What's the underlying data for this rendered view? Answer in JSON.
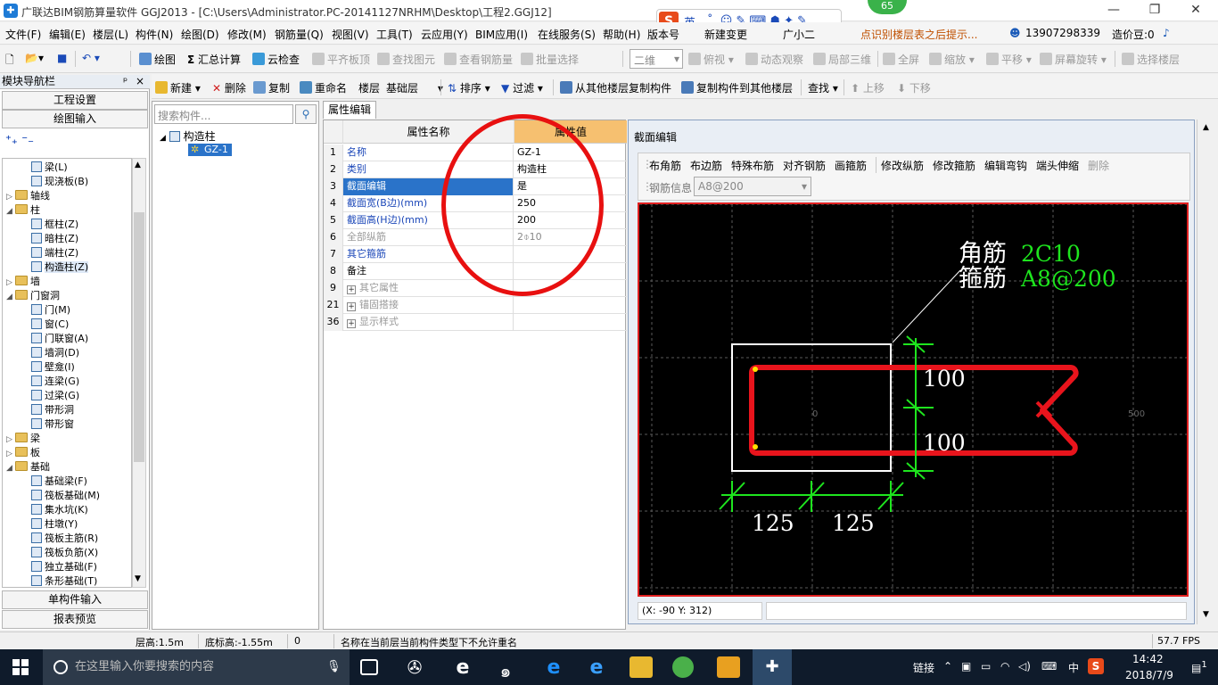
{
  "window": {
    "title": "广联达BIM钢筋算量软件 GGJ2013 - [C:\\Users\\Administrator.PC-20141127NRHM\\Desktop\\工程2.GGJ12]",
    "minimize": "—",
    "restore": "❐",
    "close": "✕"
  },
  "badge": "65",
  "ime": {
    "logo": "S",
    "mode": "英"
  },
  "menu": [
    "文件(F)",
    "编辑(E)",
    "楼层(L)",
    "构件(N)",
    "绘图(D)",
    "修改(M)",
    "钢筋量(Q)",
    "视图(V)",
    "工具(T)",
    "云应用(Y)",
    "BIM应用(I)",
    "在线服务(S)",
    "帮助(H)",
    "版本号",
    "新建变更",
    "广小二"
  ],
  "menu_right": {
    "tip": "点识别楼层表之后提示...",
    "phone": "13907298339",
    "coins": "造价豆:0"
  },
  "toolbar1": {
    "draw": "绘图",
    "calc": "汇总计算",
    "cloud_check": "云检查",
    "align_top": "平齐板顶",
    "find_elem": "查找图元",
    "view_rebar": "查看钢筋量",
    "batch_select": "批量选择",
    "view_mode": "二维",
    "top_view": "俯视",
    "dynamic_view": "动态观察",
    "local_3d": "局部三维",
    "fullscreen": "全屏",
    "zoom": "缩放",
    "pan": "平移",
    "rotate": "屏幕旋转",
    "select_floor": "选择楼层"
  },
  "nav": {
    "header": "模块导航栏",
    "pin": "ᵖ",
    "close": "×",
    "project_settings": "工程设置",
    "drawing_input": "绘图输入",
    "single_input": "单构件输入",
    "report_preview": "报表预览",
    "tree": [
      {
        "label": "梁(L)",
        "indent": 2,
        "type": "item"
      },
      {
        "label": "现浇板(B)",
        "indent": 2,
        "type": "item"
      },
      {
        "label": "轴线",
        "indent": 0,
        "type": "folder",
        "toggle": "▷"
      },
      {
        "label": "柱",
        "indent": 0,
        "type": "folder",
        "toggle": "◢"
      },
      {
        "label": "框柱(Z)",
        "indent": 2,
        "type": "item"
      },
      {
        "label": "暗柱(Z)",
        "indent": 2,
        "type": "item"
      },
      {
        "label": "端柱(Z)",
        "indent": 2,
        "type": "item"
      },
      {
        "label": "构造柱(Z)",
        "indent": 2,
        "type": "item",
        "selected": true
      },
      {
        "label": "墙",
        "indent": 0,
        "type": "folder",
        "toggle": "▷"
      },
      {
        "label": "门窗洞",
        "indent": 0,
        "type": "folder",
        "toggle": "◢"
      },
      {
        "label": "门(M)",
        "indent": 2,
        "type": "item"
      },
      {
        "label": "窗(C)",
        "indent": 2,
        "type": "item"
      },
      {
        "label": "门联窗(A)",
        "indent": 2,
        "type": "item"
      },
      {
        "label": "墙洞(D)",
        "indent": 2,
        "type": "item"
      },
      {
        "label": "壁龛(I)",
        "indent": 2,
        "type": "item"
      },
      {
        "label": "连梁(G)",
        "indent": 2,
        "type": "item"
      },
      {
        "label": "过梁(G)",
        "indent": 2,
        "type": "item"
      },
      {
        "label": "带形洞",
        "indent": 2,
        "type": "item"
      },
      {
        "label": "带形窗",
        "indent": 2,
        "type": "item"
      },
      {
        "label": "梁",
        "indent": 0,
        "type": "folder",
        "toggle": "▷"
      },
      {
        "label": "板",
        "indent": 0,
        "type": "folder",
        "toggle": "▷"
      },
      {
        "label": "基础",
        "indent": 0,
        "type": "folder",
        "toggle": "◢"
      },
      {
        "label": "基础梁(F)",
        "indent": 2,
        "type": "item"
      },
      {
        "label": "筏板基础(M)",
        "indent": 2,
        "type": "item"
      },
      {
        "label": "集水坑(K)",
        "indent": 2,
        "type": "item"
      },
      {
        "label": "柱墩(Y)",
        "indent": 2,
        "type": "item"
      },
      {
        "label": "筏板主筋(R)",
        "indent": 2,
        "type": "item"
      },
      {
        "label": "筏板负筋(X)",
        "indent": 2,
        "type": "item"
      },
      {
        "label": "独立基础(F)",
        "indent": 2,
        "type": "item"
      },
      {
        "label": "条形基础(T)",
        "indent": 2,
        "type": "item"
      }
    ]
  },
  "toolbar2": {
    "new": "新建",
    "delete": "删除",
    "copy": "复制",
    "rename": "重命名",
    "floor_label": "楼层",
    "floor_value": "基础层",
    "sort": "排序",
    "filter": "过滤",
    "copy_from": "从其他楼层复制构件",
    "copy_to": "复制构件到其他楼层",
    "find": "查找",
    "move_up": "上移",
    "move_down": "下移"
  },
  "components": {
    "search_placeholder": "搜索构件...",
    "root": "构造柱",
    "child": "GZ-1"
  },
  "props": {
    "tab": "属性编辑",
    "col_name": "属性名称",
    "col_value": "属性值",
    "rows": [
      {
        "n": "1",
        "k": "名称",
        "v": "GZ-1",
        "style": "blue"
      },
      {
        "n": "2",
        "k": "类别",
        "v": "构造柱",
        "style": "blue"
      },
      {
        "n": "3",
        "k": "截面编辑",
        "v": "是",
        "style": "blue",
        "selected": true
      },
      {
        "n": "4",
        "k": "截面宽(B边)(mm)",
        "v": "250",
        "style": "blue"
      },
      {
        "n": "5",
        "k": "截面高(H边)(mm)",
        "v": "200",
        "style": "blue"
      },
      {
        "n": "6",
        "k": "全部纵筋",
        "v": "2⌽10",
        "style": "gray"
      },
      {
        "n": "7",
        "k": "其它箍筋",
        "v": "",
        "style": "blue"
      },
      {
        "n": "8",
        "k": "备注",
        "v": "",
        "style": "black"
      },
      {
        "n": "9",
        "k": "其它属性",
        "v": "",
        "style": "gray",
        "plus": true
      },
      {
        "n": "21",
        "k": "锚固搭接",
        "v": "",
        "style": "gray",
        "plus": true
      },
      {
        "n": "36",
        "k": "显示样式",
        "v": "",
        "style": "gray",
        "plus": true
      }
    ]
  },
  "section": {
    "title": "截面编辑",
    "tools": [
      "布角筋",
      "布边筋",
      "特殊布筋",
      "对齐钢筋",
      "画箍筋",
      "修改纵筋",
      "修改箍筋",
      "编辑弯钩",
      "端头伸缩",
      "删除"
    ],
    "rebar_info_label": "钢筋信息",
    "rebar_info_value": "A8@200",
    "corner_label": "角筋",
    "corner_value": "2C10",
    "stirrup_label": "箍筋",
    "stirrup_value": "A8@200",
    "dim_v1": "100",
    "dim_v2": "100",
    "dim_h1": "125",
    "dim_h2": "125",
    "axis_zero": "0",
    "axis_500": "500",
    "coord": "(X: -90 Y: 312)"
  },
  "status": {
    "floor_height": "层高:1.5m",
    "bottom_elev": "底标高:-1.55m",
    "zero": "0",
    "message": "名称在当前层当前构件类型下不允许重名",
    "fps": "57.7 FPS"
  },
  "taskbar": {
    "search": "在这里输入你要搜索的内容",
    "link": "链接",
    "lang": "中",
    "time": "14:42",
    "date": "2018/7/9",
    "notify": "1"
  },
  "colors": {
    "accent_blue": "#2a73c9",
    "rebar_red": "#e8141c",
    "dim_green": "#1ee51e",
    "taskbar": "#0f1b2b"
  }
}
